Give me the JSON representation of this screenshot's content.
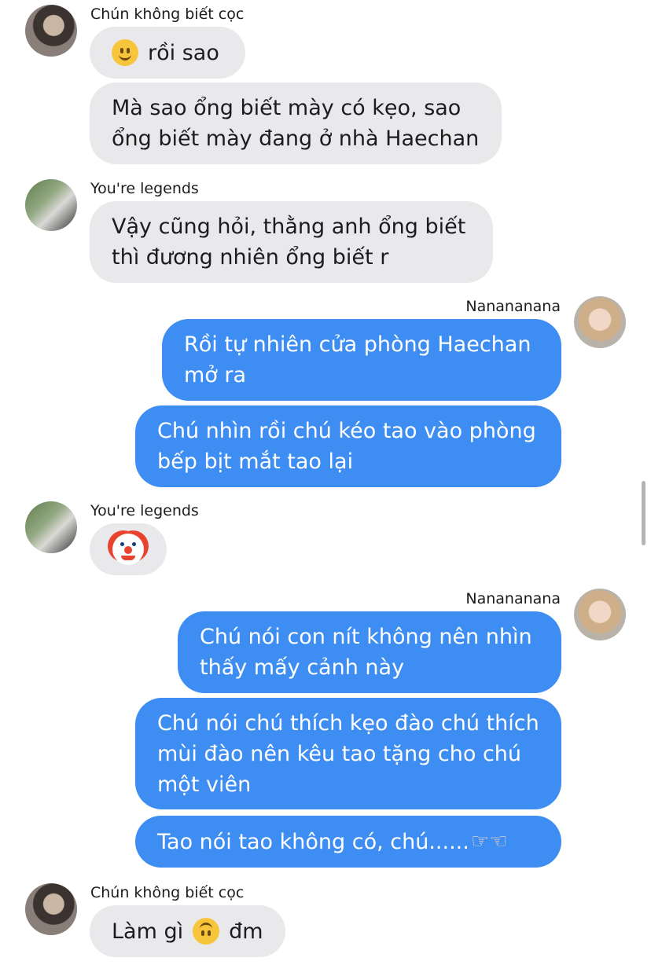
{
  "senders": {
    "chun": "Chún không biết cọc",
    "legends": "You're legends",
    "nana": "Nanananana"
  },
  "messages": {
    "m1": "rồi sao",
    "m2": "Mà sao ổng biết mày có kẹo, sao ổng biết mày đang ở nhà Haechan",
    "m3": "Vậy cũng hỏi, thằng anh ổng biết thì đương nhiên ổng biết r",
    "m4": "Rồi tự nhiên cửa phòng Haechan mở ra",
    "m5": "Chú nhìn rồi chú kéo tao vào phòng bếp bịt mắt tao lại",
    "m7": "Chú nói con nít không nên nhìn thấy mấy cảnh này",
    "m8": "Chú nói chú thích kẹo đào chú thích mùi đào nên kêu tao tặng cho chú một viên",
    "m9": "Tao nói tao không có, chú......",
    "m10a": "Làm gì",
    "m10b": "đm"
  },
  "emoji": {
    "smile": "slightly-smiling-face",
    "clown": "clown-face",
    "upside_down": "upside-down-face",
    "pointing": "pointing-hands"
  },
  "colors": {
    "incoming_bubble": "#e9e9eb",
    "outgoing_bubble": "#3e8df2"
  }
}
